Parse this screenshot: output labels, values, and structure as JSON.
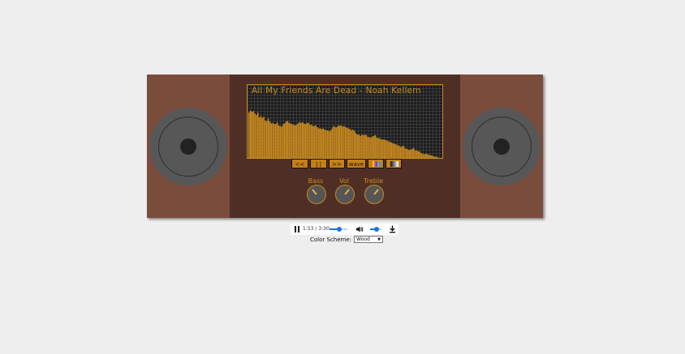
{
  "player": {
    "track_title": "All My Friends Are Dead - Noah Kellem",
    "controls": {
      "prev_label": "<<",
      "pause_label": "| |",
      "next_label": ">>",
      "wave_label": "wave"
    },
    "knobs": [
      {
        "label": "Bass"
      },
      {
        "label": "Vol"
      },
      {
        "label": "Treble"
      }
    ],
    "visualizer_levels": [
      0.74,
      0.77,
      0.75,
      0.76,
      0.72,
      0.7,
      0.74,
      0.66,
      0.68,
      0.65,
      0.67,
      0.61,
      0.6,
      0.64,
      0.59,
      0.56,
      0.57,
      0.55,
      0.55,
      0.58,
      0.53,
      0.52,
      0.51,
      0.55,
      0.56,
      0.59,
      0.6,
      0.57,
      0.56,
      0.55,
      0.54,
      0.53,
      0.54,
      0.56,
      0.58,
      0.57,
      0.58,
      0.56,
      0.55,
      0.57,
      0.57,
      0.54,
      0.54,
      0.52,
      0.52,
      0.53,
      0.5,
      0.48,
      0.48,
      0.47,
      0.48,
      0.46,
      0.45,
      0.45,
      0.43,
      0.45,
      0.48,
      0.52,
      0.5,
      0.5,
      0.53,
      0.52,
      0.53,
      0.51,
      0.52,
      0.5,
      0.49,
      0.48,
      0.47,
      0.45,
      0.46,
      0.44,
      0.4,
      0.38,
      0.38,
      0.36,
      0.38,
      0.37,
      0.38,
      0.37,
      0.34,
      0.34,
      0.33,
      0.35,
      0.36,
      0.37,
      0.33,
      0.32,
      0.32,
      0.3,
      0.3,
      0.3,
      0.29,
      0.28,
      0.27,
      0.26,
      0.25,
      0.24,
      0.23,
      0.22,
      0.21,
      0.2,
      0.18,
      0.19,
      0.2,
      0.16,
      0.15,
      0.14,
      0.13,
      0.14,
      0.15,
      0.16,
      0.12,
      0.12,
      0.11,
      0.1,
      0.08,
      0.07,
      0.06,
      0.07,
      0.06,
      0.05,
      0.05,
      0.04,
      0.03,
      0.02,
      0.02,
      0.01,
      0.0,
      0.0
    ],
    "colors": {
      "accent": "#c98a1f",
      "speaker_panel": "#7a4c3c",
      "body": "#4f2f25"
    }
  },
  "audio": {
    "current_time": "1:53",
    "duration": "3:30",
    "time_display": "1:53 / 3:30",
    "progress": 0.54,
    "volume_level": 0.55
  },
  "scheme": {
    "label": "Color Scheme:",
    "selected": "Wood"
  },
  "icons": {
    "pause": "pause-icon",
    "volume": "volume-icon",
    "download": "download-icon"
  }
}
